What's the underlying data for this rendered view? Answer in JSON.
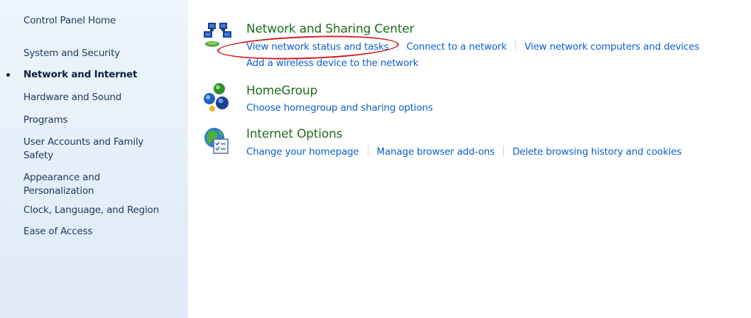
{
  "sidebar": {
    "items": [
      {
        "label": "Control Panel Home"
      },
      {
        "label": "System and Security"
      },
      {
        "label": "Network and Internet",
        "active": true
      },
      {
        "label": "Hardware and Sound"
      },
      {
        "label": "Programs"
      },
      {
        "label": "User Accounts and Family",
        "label2": "Safety"
      },
      {
        "label": "Appearance and",
        "label2": "Personalization"
      },
      {
        "label": "Clock, Language, and Region"
      },
      {
        "label": "Ease of Access"
      }
    ]
  },
  "categories": [
    {
      "title": "Network and Sharing Center",
      "icon": "network-sharing-icon",
      "tasks_row1": [
        "View network status and tasks",
        "Connect to a network",
        "View network computers and devices"
      ],
      "tasks_row2": [
        "Add a wireless device to the network"
      ]
    },
    {
      "title": "HomeGroup",
      "icon": "homegroup-icon",
      "tasks_row1": [
        "Choose homegroup and sharing options"
      ]
    },
    {
      "title": "Internet Options",
      "icon": "internet-options-icon",
      "tasks_row1": [
        "Change your homepage",
        "Manage browser add-ons",
        "Delete browsing history and cookies"
      ]
    }
  ],
  "colors": {
    "sidebar_bg": "#e4eef9",
    "category_title": "#1e6b1e",
    "task_link": "#0b5ecf",
    "annotation_ring": "#cc1a1a"
  }
}
